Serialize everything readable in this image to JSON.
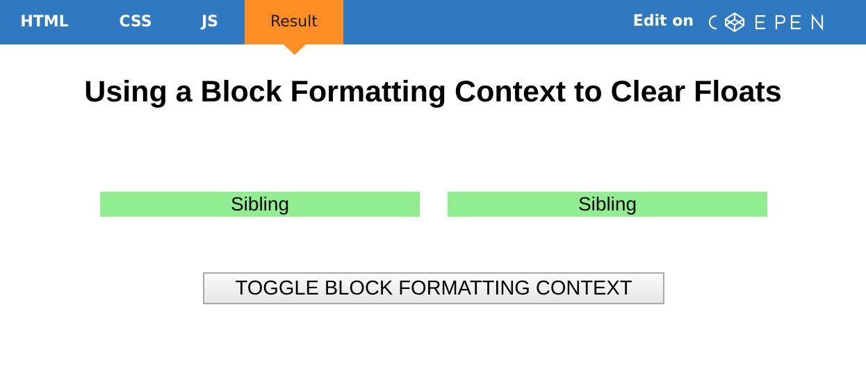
{
  "tabs": {
    "html": "HTML",
    "css": "CSS",
    "js": "JS",
    "result": "Result"
  },
  "edit_on": {
    "label": "Edit on",
    "logo": {
      "text": "CODEPEN",
      "icon": "codepen-cube-icon"
    }
  },
  "colors": {
    "topbar": "#2f79c0",
    "active_tab": "#ff8f25",
    "sibling_bg": "#90ee90"
  },
  "main": {
    "title": "Using a Block Formatting Context to Clear Floats",
    "siblings": [
      "Sibling",
      "Sibling"
    ],
    "toggle_button": "TOGGLE BLOCK FORMATTING CONTEXT"
  }
}
